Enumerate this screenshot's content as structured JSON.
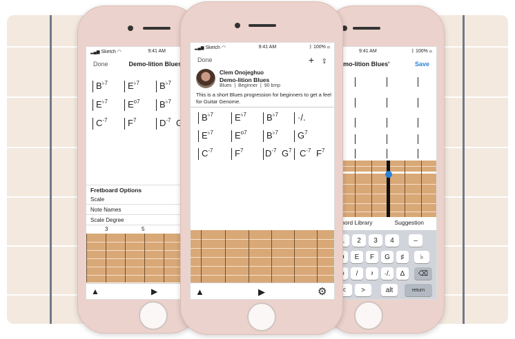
{
  "left_phone": {
    "status": {
      "carrier": "Sketch",
      "time": "9:41 AM"
    },
    "nav": {
      "left": "Done",
      "title": "Demo-lition Blues"
    },
    "rows": [
      [
        {
          "root": "B",
          "acc": "♭",
          "q": "7"
        },
        {
          "root": "E",
          "acc": "♭",
          "q": "7"
        },
        {
          "root": "B",
          "acc": "♭",
          "q": "7"
        }
      ],
      [
        {
          "root": "E",
          "acc": "♭",
          "q": "7"
        },
        {
          "root": "E",
          "acc": "",
          "q": "o7"
        },
        {
          "root": "B",
          "acc": "♭",
          "q": "7"
        }
      ],
      [
        {
          "root": "C",
          "acc": "",
          "q": "-7"
        },
        {
          "root": "F",
          "acc": "",
          "q": "7"
        },
        {
          "root": "D",
          "acc": "",
          "q": "-7"
        },
        {
          "root": "G",
          "acc": "",
          "q": ""
        }
      ]
    ],
    "options_title": "Fretboard Options",
    "options": [
      "Scale",
      "Note Names",
      "Scale Degree"
    ],
    "fret_numbers": [
      "3",
      "5"
    ]
  },
  "center_phone": {
    "status": {
      "carrier": "Sketch",
      "time": "9:41 AM",
      "battery": "100%"
    },
    "nav": {
      "left": "Done"
    },
    "author": "Clem Onojeghuo",
    "song_title": "Demo-lition Blues",
    "meta": "Blues  |  Beginner  |  90 bmp",
    "description": "This is a short Blues progression for beginners to get a feel for Guitar Genome.",
    "rows": [
      [
        {
          "root": "B",
          "acc": "♭",
          "q": "7"
        },
        {
          "root": "E",
          "acc": "♭",
          "q": "7"
        },
        {
          "root": "B",
          "acc": "♭",
          "q": "7"
        },
        {
          "root": "·/.",
          "acc": "",
          "q": ""
        }
      ],
      [
        {
          "root": "E",
          "acc": "♭",
          "q": "7"
        },
        {
          "root": "E",
          "acc": "",
          "q": "o7"
        },
        {
          "root": "B",
          "acc": "♭",
          "q": "7"
        },
        {
          "root": "G",
          "acc": "",
          "q": "7"
        }
      ],
      [
        {
          "root": "C",
          "acc": "",
          "q": "-7"
        },
        {
          "root": "F",
          "acc": "",
          "q": "7"
        },
        {
          "root": "D",
          "acc": "",
          "q": "-7"
        },
        {
          "root": "G",
          "acc": "",
          "q": "7"
        },
        {
          "root": "C",
          "acc": "",
          "q": "-7"
        },
        {
          "root": "F",
          "acc": "",
          "q": "7"
        }
      ]
    ]
  },
  "right_phone": {
    "status": {
      "time": "9:41 AM",
      "battery": "100%"
    },
    "nav": {
      "title": ": 'Demo-lition Blues'",
      "save": "Save"
    },
    "tabs": [
      "Chord Library",
      "Suggestion"
    ],
    "keys_row1": [
      "1",
      "2",
      "3",
      "4",
      "–"
    ],
    "keys_row2": [
      "D",
      "E",
      "F",
      "G",
      "♯",
      "♭"
    ],
    "keys_row3": [
      "⊕",
      "/",
      "𝄽",
      "·/.",
      "Δ",
      "⌫"
    ],
    "keys_row4": [
      "<",
      ">",
      "alt",
      "return"
    ]
  },
  "colors": {
    "accent": "#2a82da",
    "fretboard": "#d9a877",
    "string": "#ffffff"
  }
}
